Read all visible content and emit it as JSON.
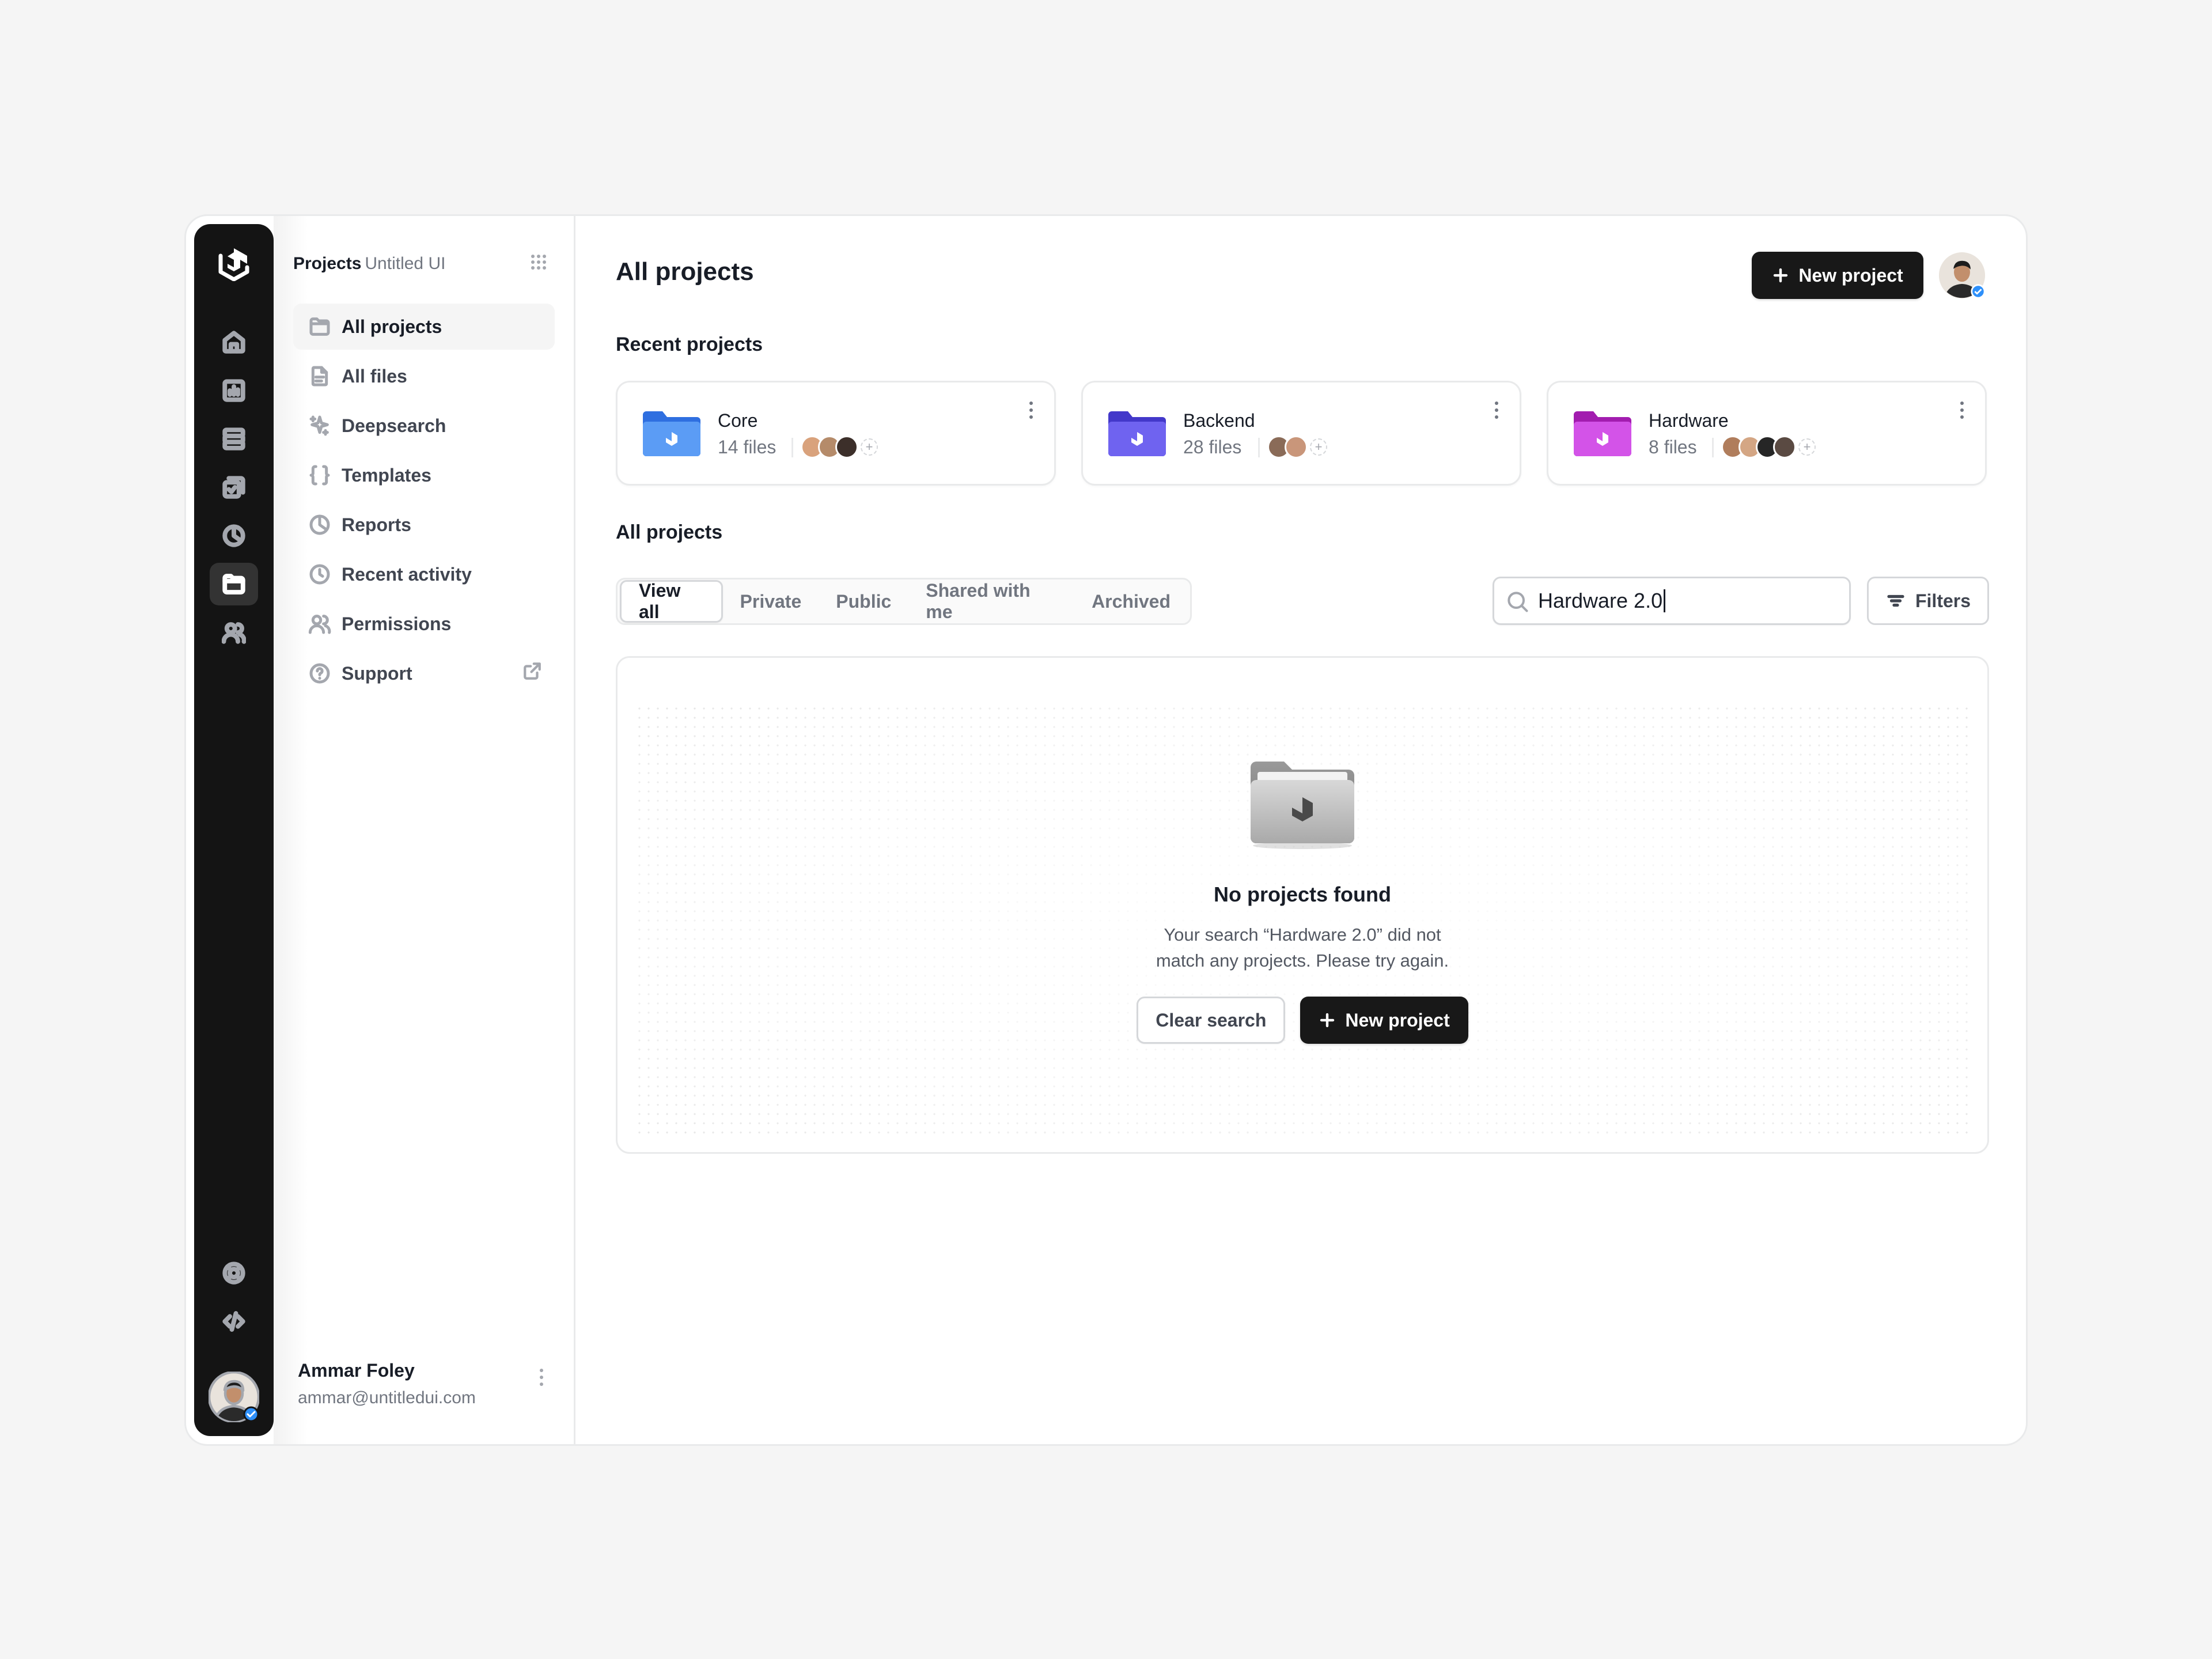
{
  "sidebar": {
    "section": "Projects",
    "workspace": "Untitled UI",
    "items": [
      {
        "label": "All projects",
        "icon": "folder-icon"
      },
      {
        "label": "All files",
        "icon": "file-icon"
      },
      {
        "label": "Deepsearch",
        "icon": "sparkles-icon"
      },
      {
        "label": "Templates",
        "icon": "braces-icon"
      },
      {
        "label": "Reports",
        "icon": "pie-chart-icon"
      },
      {
        "label": "Recent activity",
        "icon": "clock-icon"
      },
      {
        "label": "Permissions",
        "icon": "users-icon"
      },
      {
        "label": "Support",
        "icon": "help-circle-icon"
      }
    ],
    "user": {
      "name": "Ammar Foley",
      "email": "ammar@untitledui.com"
    }
  },
  "header": {
    "title": "All projects",
    "new_project_label": "New project"
  },
  "recent": {
    "title": "Recent projects",
    "cards": [
      {
        "name": "Core",
        "files": "14 files",
        "color": "#3b82f6"
      },
      {
        "name": "Backend",
        "files": "28 files",
        "color": "#6366f1"
      },
      {
        "name": "Hardware",
        "files": "8 files",
        "color": "#c026d3"
      }
    ]
  },
  "all": {
    "title": "All projects",
    "tabs": [
      "View all",
      "Private",
      "Public",
      "Shared with me",
      "Archived"
    ],
    "active_tab": "View all",
    "search_value": "Hardware 2.0",
    "filters_label": "Filters"
  },
  "empty": {
    "title": "No projects found",
    "description": "Your search “Hardware 2.0” did not match any projects. Please try again.",
    "clear_label": "Clear search",
    "new_label": "New project"
  },
  "colors": {
    "accent_dark": "#181818",
    "rail": "#141414",
    "border": "#e9eaeb"
  }
}
